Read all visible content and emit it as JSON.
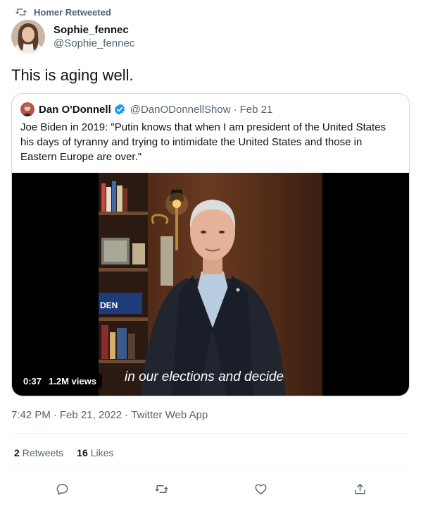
{
  "retweet_header": {
    "label": "Homer Retweeted",
    "icon": "retweet-icon"
  },
  "author": {
    "display_name": "Sophie_fennec",
    "handle": "@Sophie_fennec"
  },
  "tweet": {
    "text": "This is aging well."
  },
  "quoted_tweet": {
    "display_name": "Dan O'Donnell",
    "verified": true,
    "handle": "@DanODonnellShow",
    "separator": "·",
    "date": "Feb 21",
    "text": "Joe Biden in 2019: \"Putin knows that when I am president of the United States his days of tyranny and trying to intimidate the United States and those in Eastern Europe are over.\"",
    "video": {
      "duration": "0:37",
      "views": "1.2M views",
      "caption": "in our elections and decide"
    }
  },
  "meta": {
    "time": "7:42 PM",
    "sep1": "·",
    "date": "Feb 21, 2022",
    "sep2": "·",
    "source": "Twitter Web App"
  },
  "stats": {
    "retweets_count": "2",
    "retweets_label": "Retweets",
    "likes_count": "16",
    "likes_label": "Likes"
  },
  "actions": [
    {
      "name": "reply",
      "icon": "reply-icon"
    },
    {
      "name": "retweet",
      "icon": "retweet-icon"
    },
    {
      "name": "like",
      "icon": "heart-icon"
    },
    {
      "name": "share",
      "icon": "share-icon"
    }
  ],
  "colors": {
    "text": "#0f1419",
    "secondary": "#536471",
    "verified": "#1d9bf0",
    "border": "#cfd9de"
  }
}
